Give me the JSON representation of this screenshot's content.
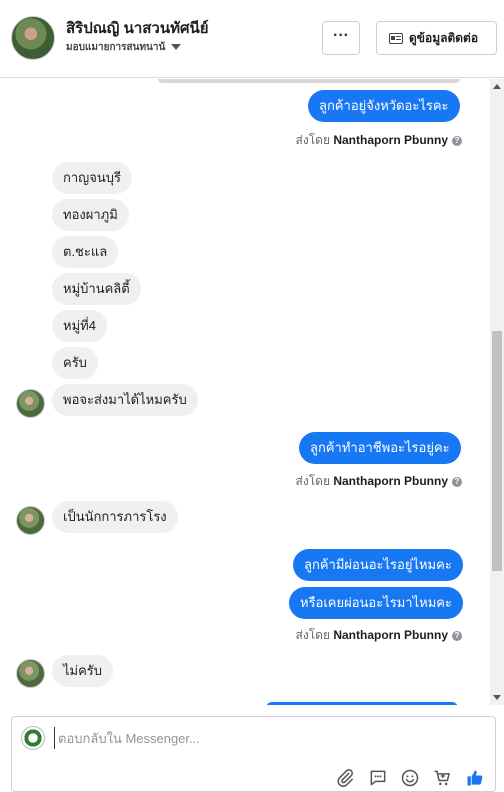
{
  "header": {
    "name": "สิริปณญิ นาสวนทัศนีย์",
    "subtitle": "มอบแมายการสนทนาน้",
    "more_label": "···",
    "contact_label": "ดูข้อมูลติดต่อ"
  },
  "thread": {
    "messages": [
      {
        "dir": "out",
        "text": "ลูกค้าอยู่จังหวัดอะไรคะ"
      },
      {
        "dir": "meta",
        "sent_by_prefix": "ส่งโดย",
        "sent_by_name": "Nanthaporn Pbunny"
      },
      {
        "dir": "in",
        "text": "กาญจนบุรี"
      },
      {
        "dir": "in",
        "text": "ทองผาภูมิ"
      },
      {
        "dir": "in",
        "text": "ต.ชะแล"
      },
      {
        "dir": "in",
        "text": "หมู่บ้านคลิตี้"
      },
      {
        "dir": "in",
        "text": "หมู่ที่4"
      },
      {
        "dir": "in",
        "text": "ครับ"
      },
      {
        "dir": "in",
        "text": "พอจะส่งมาได้ไหมครับ"
      },
      {
        "dir": "out",
        "text": "ลูกค้าทำอาชีพอะไรอยู่คะ"
      },
      {
        "dir": "meta",
        "sent_by_prefix": "ส่งโดย",
        "sent_by_name": "Nanthaporn Pbunny"
      },
      {
        "dir": "in",
        "text": "เป็นนักการภารโรง"
      },
      {
        "dir": "out",
        "text": "ลูกค้ามีผ่อนอะไรอยู่ไหมคะ"
      },
      {
        "dir": "out",
        "text": "หรือเคยผ่อนอะไรมาไหมคะ"
      },
      {
        "dir": "meta",
        "sent_by_prefix": "ส่งโดย",
        "sent_by_name": "Nanthaporn Pbunny"
      },
      {
        "dir": "in",
        "text": "ไม่ครับ"
      }
    ]
  },
  "composer": {
    "placeholder": "ตอบกลับใน Messenger...",
    "icons": [
      "paperclip-icon",
      "chat-bubble-icon",
      "emoji-icon",
      "cart-icon",
      "thumbs-up-icon"
    ]
  },
  "colors": {
    "outgoing": "#1877f2",
    "incoming": "#f0f0f0",
    "like": "#1877f2"
  }
}
